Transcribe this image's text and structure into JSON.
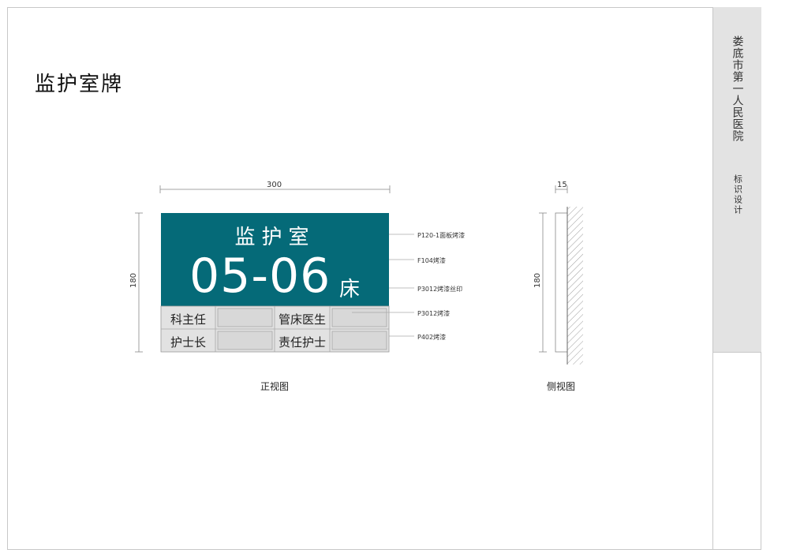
{
  "page_title": "监护室牌",
  "sidebar": {
    "hospital": "娄底市第一人民医院",
    "subtitle": "标识设计"
  },
  "sign": {
    "room_name": "监护室",
    "bed_number": "05-06",
    "bed_unit": "床",
    "rows": [
      {
        "left_label": "科主任",
        "right_label": "管床医生"
      },
      {
        "left_label": "护士长",
        "right_label": "责任护士"
      }
    ]
  },
  "specs": [
    "P120-1面板烤漆",
    "F104烤漆",
    "P3012烤漆丝印",
    "P3012烤漆",
    "P402烤漆"
  ],
  "dimensions": {
    "width": "300",
    "height_front": "180",
    "depth": "15",
    "height_side": "180"
  },
  "views": {
    "front": "正视图",
    "side": "侧视图"
  },
  "colors": {
    "panel": "#056a78",
    "info_area": "#e2e2e2",
    "sidebar": "#e3e3e3"
  }
}
